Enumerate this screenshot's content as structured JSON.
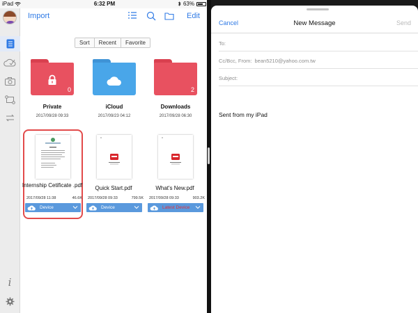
{
  "status": {
    "device": "iPad",
    "time": "6:32 PM",
    "battery": "63%"
  },
  "toolbar": {
    "import_label": "Import",
    "edit_label": "Edit"
  },
  "segments": [
    "Sort",
    "Recent",
    "Favorite"
  ],
  "folders": [
    {
      "name": "Private",
      "date": "2017/09/28 09:33",
      "count": "0",
      "color": "#e85160"
    },
    {
      "name": "iCloud",
      "date": "2017/09/23 04:12",
      "count": "",
      "color": "#49a6e9"
    },
    {
      "name": "Downloads",
      "date": "2017/09/28 06:30",
      "count": "2",
      "color": "#e85160"
    }
  ],
  "files": [
    {
      "name": "Internship Cetificate .pdf",
      "date": "2017/09/28 11:38",
      "size": "46.6K",
      "location": "Device"
    },
    {
      "name": "Quick Start.pdf",
      "date": "2017/09/28 09:33",
      "size": "799.5K",
      "location": "Device"
    },
    {
      "name": "What's New.pdf",
      "date": "2017/09/28 09:33",
      "size": "903.2K",
      "location": "Latest Device"
    }
  ],
  "compose": {
    "cancel_label": "Cancel",
    "title": "New Message",
    "send_label": "Send",
    "to_label": "To:",
    "cc_label": "Cc/Bcc, From:",
    "from_value": "bean5210@yahoo.com.tw",
    "subject_label": "Subject:",
    "body": "Sent from my iPad"
  },
  "colors": {
    "accent": "#2f7ae5",
    "selection": "#e24a4a",
    "device_bar": "#5a99dd"
  }
}
